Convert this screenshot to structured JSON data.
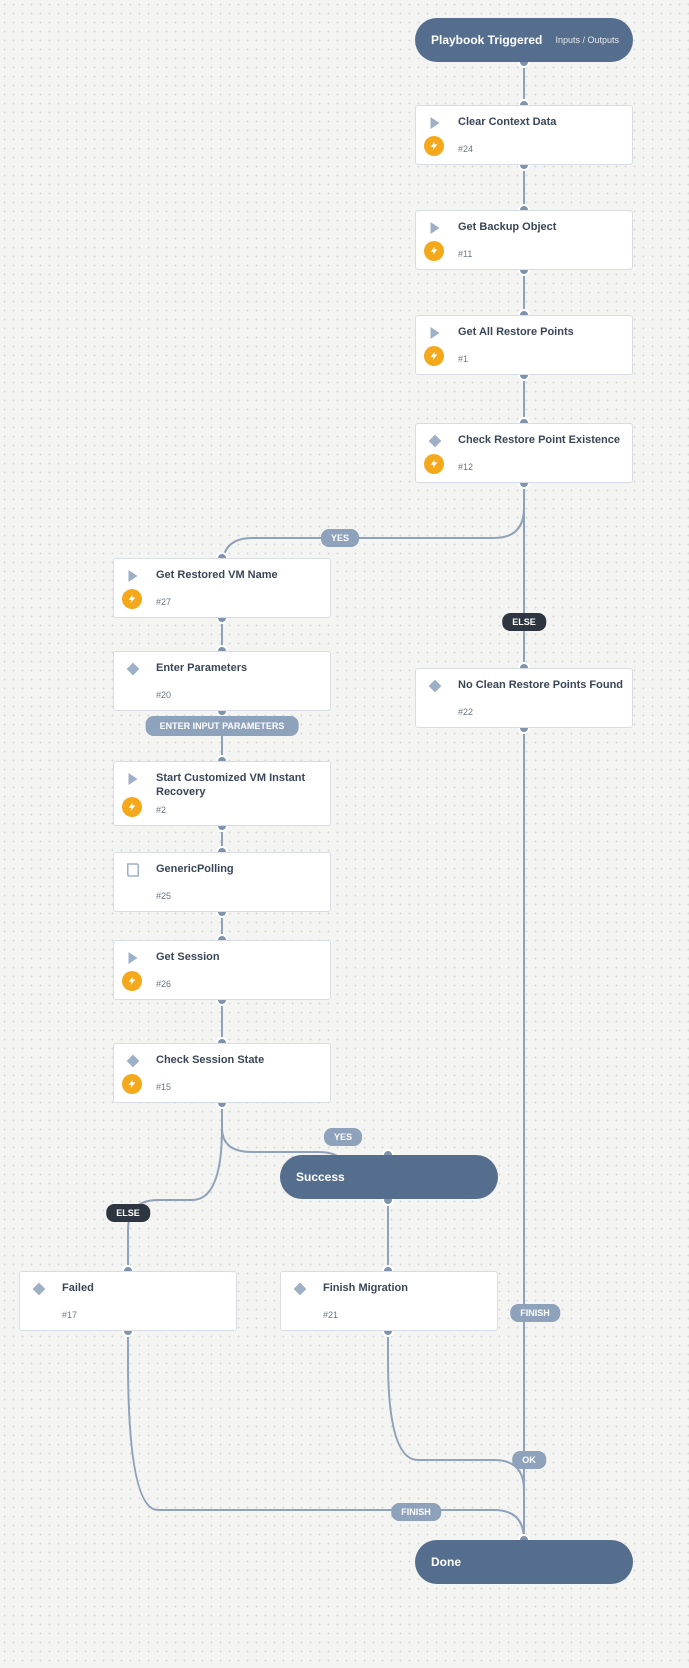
{
  "start": {
    "title": "Playbook Triggered",
    "io": "Inputs / Outputs"
  },
  "done": {
    "title": "Done"
  },
  "success": {
    "title": "Success"
  },
  "nodes": {
    "clear": {
      "title": "Clear Context Data",
      "hash": "#24"
    },
    "backup": {
      "title": "Get Backup Object",
      "hash": "#11"
    },
    "points": {
      "title": "Get All Restore Points",
      "hash": "#1"
    },
    "check": {
      "title": "Check Restore Point Existence",
      "hash": "#12"
    },
    "vmname": {
      "title": "Get Restored VM Name",
      "hash": "#27"
    },
    "params": {
      "title": "Enter Parameters",
      "hash": "#20"
    },
    "recover": {
      "title": "Start Customized VM Instant Recovery",
      "hash": "#2"
    },
    "poll": {
      "title": "GenericPolling",
      "hash": "#25"
    },
    "session": {
      "title": "Get Session",
      "hash": "#26"
    },
    "state": {
      "title": "Check Session State",
      "hash": "#15"
    },
    "noclean": {
      "title": "No Clean Restore Points Found",
      "hash": "#22"
    },
    "failed": {
      "title": "Failed",
      "hash": "#17"
    },
    "finmig": {
      "title": "Finish Migration",
      "hash": "#21"
    }
  },
  "labels": {
    "yes1": "YES",
    "else1": "ELSE",
    "input": "ENTER INPUT PARAMETERS",
    "yes2": "YES",
    "else2": "ELSE",
    "ok": "OK",
    "fin1": "FINISH",
    "fin2": "FINISH"
  }
}
